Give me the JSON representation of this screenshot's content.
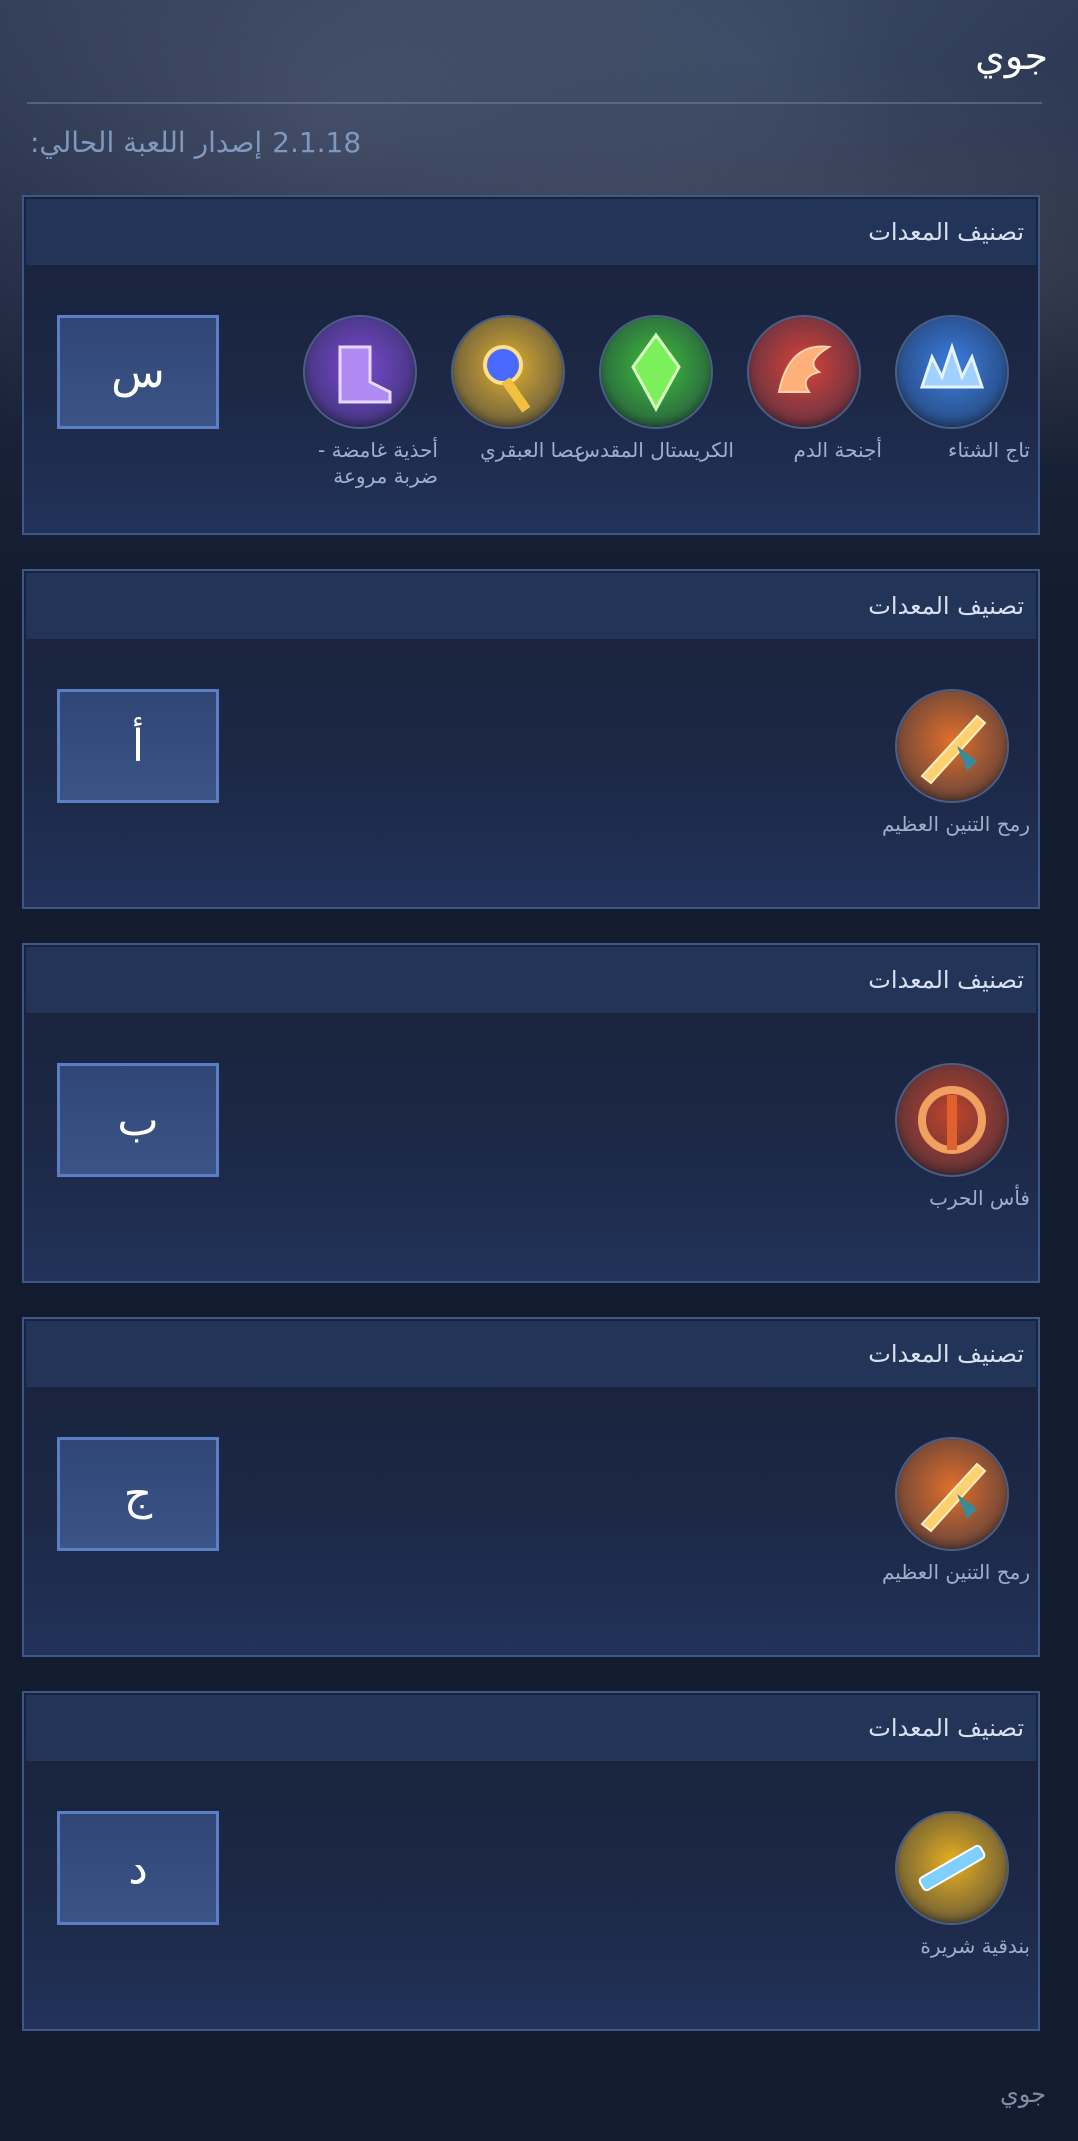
{
  "hero": {
    "name": "جوي"
  },
  "version": {
    "label": "إصدار اللعبة الحالي:",
    "number": "2.1.18"
  },
  "sections": [
    {
      "header": "تصنيف المعدات",
      "tier": "س",
      "items": [
        {
          "name": "تاج الشتاء",
          "icon": "winter-crown-icon",
          "color": "#3a7fe0"
        },
        {
          "name": "أجنحة الدم",
          "icon": "blood-wings-icon",
          "color": "#d9433a"
        },
        {
          "name": "الكريستال المقدس",
          "icon": "holy-crystal-icon",
          "color": "#3fbf3a"
        },
        {
          "name": "عصا العبقري",
          "icon": "genius-wand-icon",
          "color": "#e0b030"
        },
        {
          "name": "أحذية غامضة - ضربة مروعة",
          "icon": "arcane-boots-icon",
          "color": "#7a4ad0"
        }
      ]
    },
    {
      "header": "تصنيف المعدات",
      "tier": "أ",
      "items": [
        {
          "name": "رمح التنين العظيم",
          "icon": "great-dragon-spear-icon",
          "color": "#e0702a"
        }
      ]
    },
    {
      "header": "تصنيف المعدات",
      "tier": "ب",
      "items": [
        {
          "name": "فأس الحرب",
          "icon": "war-axe-icon",
          "color": "#c0442a"
        }
      ]
    },
    {
      "header": "تصنيف المعدات",
      "tier": "ج",
      "items": [
        {
          "name": "رمح التنين العظيم",
          "icon": "great-dragon-spear-icon",
          "color": "#e0702a"
        }
      ]
    },
    {
      "header": "تصنيف المعدات",
      "tier": "د",
      "items": [
        {
          "name": "بندقية شريرة",
          "icon": "malefic-gun-icon",
          "color": "#e8b020"
        }
      ]
    }
  ],
  "footer": {
    "text": "جوي"
  }
}
